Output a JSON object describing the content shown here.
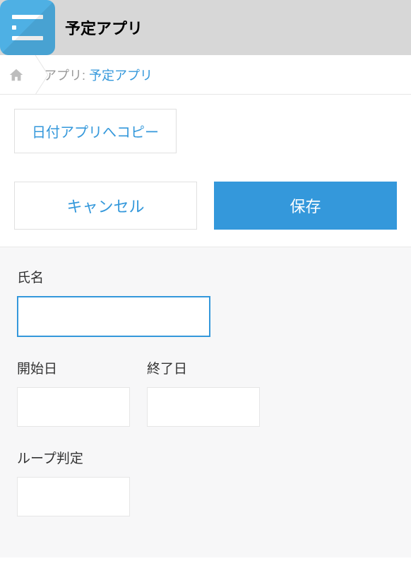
{
  "header": {
    "app_title": "予定アプリ"
  },
  "breadcrumb": {
    "prefix": "アプリ: ",
    "app_link": "予定アプリ"
  },
  "toolbar": {
    "copy_button_label": "日付アプリへコピー"
  },
  "actions": {
    "cancel_label": "キャンセル",
    "save_label": "保存"
  },
  "form": {
    "name": {
      "label": "氏名",
      "value": ""
    },
    "start_date": {
      "label": "開始日",
      "value": ""
    },
    "end_date": {
      "label": "終了日",
      "value": ""
    },
    "loop_check": {
      "label": "ループ判定",
      "value": ""
    }
  }
}
